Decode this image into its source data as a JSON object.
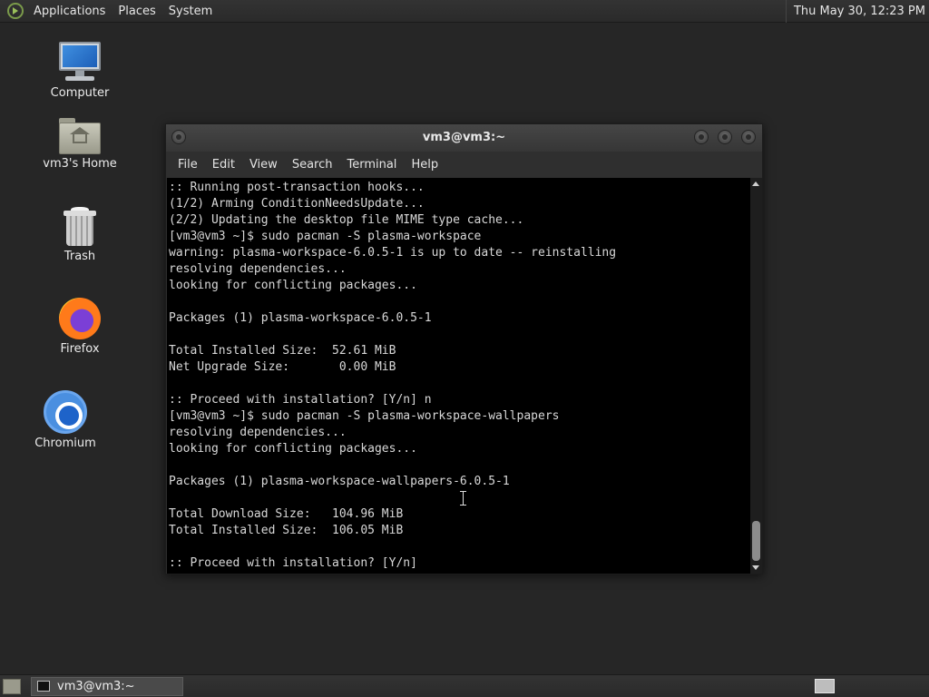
{
  "top_panel": {
    "menus": [
      "Applications",
      "Places",
      "System"
    ],
    "clock": "Thu May 30, 12:23 PM"
  },
  "desktop_icons": {
    "computer": {
      "label": "Computer",
      "icon": "computer-icon"
    },
    "home": {
      "label": "vm3's Home",
      "icon": "home-folder-icon"
    },
    "trash": {
      "label": "Trash",
      "icon": "trash-icon"
    },
    "firefox": {
      "label": "Firefox",
      "icon": "firefox-icon"
    },
    "chromium": {
      "label": "Chromium",
      "icon": "chromium-icon"
    }
  },
  "terminal": {
    "title": "vm3@vm3:~",
    "menu": [
      "File",
      "Edit",
      "View",
      "Search",
      "Terminal",
      "Help"
    ],
    "lines": [
      ":: Running post-transaction hooks...",
      "(1/2) Arming ConditionNeedsUpdate...",
      "(2/2) Updating the desktop file MIME type cache...",
      "[vm3@vm3 ~]$ sudo pacman -S plasma-workspace",
      "warning: plasma-workspace-6.0.5-1 is up to date -- reinstalling",
      "resolving dependencies...",
      "looking for conflicting packages...",
      "",
      "Packages (1) plasma-workspace-6.0.5-1",
      "",
      "Total Installed Size:  52.61 MiB",
      "Net Upgrade Size:       0.00 MiB",
      "",
      ":: Proceed with installation? [Y/n] n",
      "[vm3@vm3 ~]$ sudo pacman -S plasma-workspace-wallpapers",
      "resolving dependencies...",
      "looking for conflicting packages...",
      "",
      "Packages (1) plasma-workspace-wallpapers-6.0.5-1",
      "",
      "Total Download Size:   104.96 MiB",
      "Total Installed Size:  106.05 MiB",
      "",
      ":: Proceed with installation? [Y/n]"
    ]
  },
  "bottom_panel": {
    "task_label": "vm3@vm3:~"
  },
  "colors": {
    "desktop_bg": "#262626",
    "terminal_bg": "#000000",
    "terminal_fg": "#d8d8d8"
  }
}
